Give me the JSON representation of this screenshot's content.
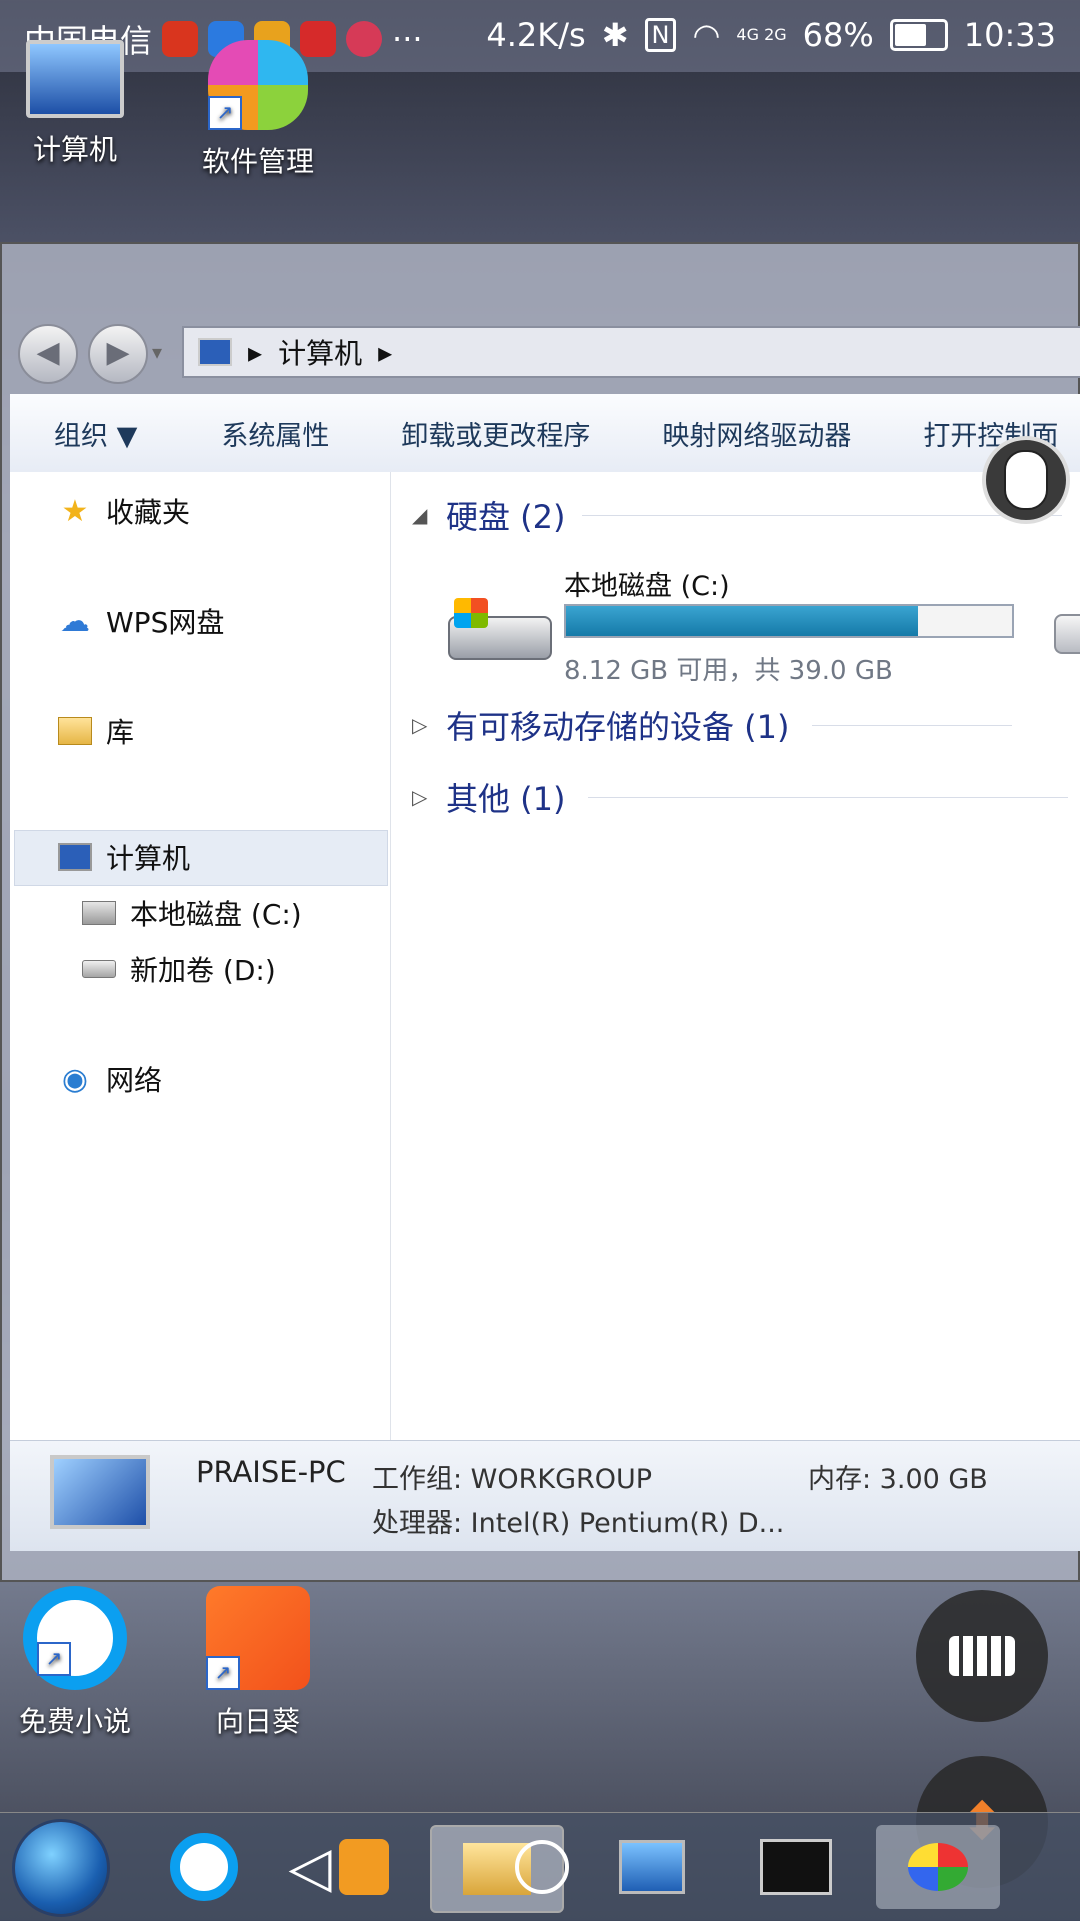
{
  "status_bar": {
    "carrier": "中国电信",
    "more": "···",
    "speed": "4.2K/s",
    "nfc": "N",
    "network": "4G 2G",
    "battery": "68%",
    "battery_level": 0.68,
    "time": "10:33"
  },
  "desktop": {
    "icons": [
      {
        "label": "计算机"
      },
      {
        "label": "软件管理"
      },
      {
        "label": "免费小说"
      },
      {
        "label": "向日葵"
      }
    ]
  },
  "window": {
    "address": {
      "crumb": "计算机",
      "separator": "▸"
    },
    "toolbar": {
      "organize": "组织 ▼",
      "system_properties": "系统属性",
      "uninstall": "卸载或更改程序",
      "map_drive": "映射网络驱动器",
      "control_panel": "打开控制面"
    },
    "nav": {
      "favorites": "收藏夹",
      "wps": "WPS网盘",
      "libraries": "库",
      "computer": "计算机",
      "drive_c": "本地磁盘 (C:)",
      "drive_d": "新加卷 (D:)",
      "network": "网络"
    },
    "groups": {
      "hard_disks": "硬盘 (2)",
      "removable": "有可移动存储的设备 (1)",
      "other": "其他 (1)"
    },
    "drive": {
      "name": "本地磁盘 (C:)",
      "free_text": "8.12 GB 可用，共 39.0 GB",
      "used_fraction": 0.79
    },
    "details": {
      "pc_name": "PRAISE-PC",
      "workgroup_label": "工作组: WORKGROUP",
      "memory_label": "内存: 3.00 GB",
      "cpu_label": "处理器: Intel(R) Pentium(R) D..."
    }
  }
}
